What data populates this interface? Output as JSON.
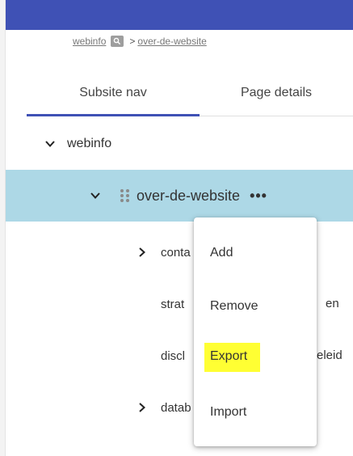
{
  "breadcrumb": {
    "root": "webinfo",
    "separator": ">",
    "current": "over-de-website"
  },
  "tabs": [
    {
      "label": "Subsite nav",
      "active": true
    },
    {
      "label": "Page details",
      "active": false
    }
  ],
  "tree": {
    "root": {
      "label": "webinfo",
      "expanded": true
    },
    "selected": {
      "label": "over-de-website",
      "more": "•••"
    },
    "children": [
      {
        "label_visible": "conta",
        "has_children": true
      },
      {
        "label_visible": "strat",
        "tail_visible": "en",
        "has_children": false
      },
      {
        "label_visible": "discl",
        "tail_visible": "eleid",
        "has_children": false
      },
      {
        "label_visible": "datab",
        "has_children": true
      }
    ]
  },
  "context_menu": {
    "items": [
      "Add",
      "Remove",
      "Export",
      "Import"
    ],
    "highlighted": "Export"
  },
  "colors": {
    "header": "#3f51b5",
    "selected_row": "#add8e6",
    "highlight": "#ffff33",
    "tab_indicator": "#3f51b5"
  }
}
